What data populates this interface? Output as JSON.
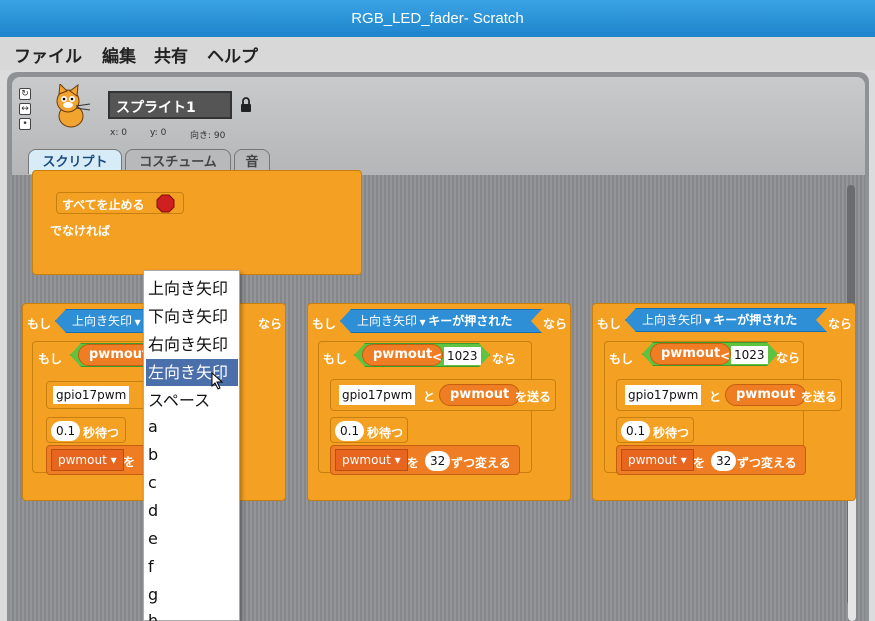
{
  "window": {
    "title": "RGB_LED_fader- Scratch"
  },
  "menu": {
    "items": [
      "ファイル",
      "編集",
      "共有",
      "ヘルプ"
    ]
  },
  "sprite": {
    "name": "スプライト1",
    "x_label": "x: 0",
    "y_label": "y: 0",
    "direction_label": "向き: 90"
  },
  "tabs": {
    "script": "スクリプト",
    "costume": "コスチューム",
    "sound": "音"
  },
  "script_blocks": {
    "stop_all": "すべてを止める",
    "else": "でなければ",
    "if": "もし",
    "then": "なら",
    "key_option": "上向き矢印",
    "key_pressed": "キーが押された",
    "variable": "pwmout",
    "less_than": "<",
    "threshold": "1023",
    "broadcast_name": "gpio17pwm",
    "and": "と",
    "send": "を送る",
    "wait_value": "0.1",
    "wait_seconds": "秒待つ",
    "change_var": "pwmout",
    "change_by": "を",
    "change_amount": "32",
    "change_suffix": "ずつ変える"
  },
  "key_dropdown": {
    "items": [
      "上向き矢印",
      "下向き矢印",
      "右向き矢印",
      "左向き矢印",
      "スペース",
      "a",
      "b",
      "c",
      "d",
      "e",
      "f",
      "g",
      "h"
    ],
    "highlighted": "左向き矢印"
  },
  "colors": {
    "control_block": "#f4a123",
    "sensing_block": "#2e8fd6",
    "operator_block": "#5ec440",
    "variable_block": "#ee7d23",
    "selected_item": "#4a6faa"
  }
}
